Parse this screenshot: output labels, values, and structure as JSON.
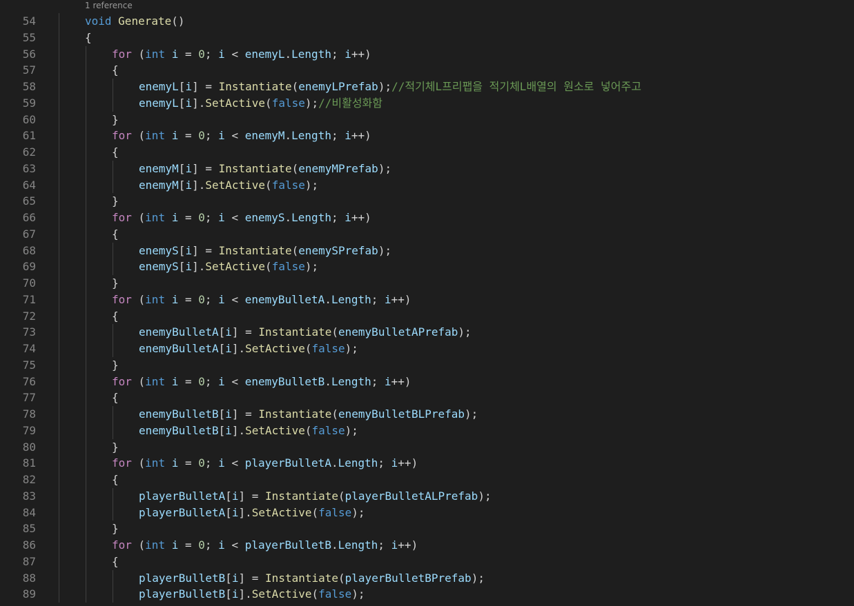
{
  "editor": {
    "codelens": "1 reference",
    "colors": {
      "background": "#1e1e1e",
      "line_number": "#858585",
      "keyword": "#569cd6",
      "control": "#c586c0",
      "function": "#dcdcaa",
      "variable": "#9cdcfe",
      "number": "#b5cea8",
      "comment": "#6a9955",
      "punctuation": "#d4d4d4"
    },
    "lines": [
      {
        "num": "54",
        "indent": 1,
        "tokens": [
          [
            "kw",
            "void"
          ],
          [
            "pn",
            " "
          ],
          [
            "fn",
            "Generate"
          ],
          [
            "pn",
            "()"
          ]
        ]
      },
      {
        "num": "55",
        "indent": 1,
        "tokens": [
          [
            "pn",
            "{"
          ]
        ]
      },
      {
        "num": "56",
        "indent": 2,
        "tokens": [
          [
            "ctl",
            "for"
          ],
          [
            "pn",
            " ("
          ],
          [
            "kw",
            "int"
          ],
          [
            "pn",
            " "
          ],
          [
            "var",
            "i"
          ],
          [
            "pn",
            " = "
          ],
          [
            "num",
            "0"
          ],
          [
            "pn",
            "; "
          ],
          [
            "var",
            "i"
          ],
          [
            "pn",
            " < "
          ],
          [
            "var",
            "enemyL"
          ],
          [
            "pn",
            "."
          ],
          [
            "var",
            "Length"
          ],
          [
            "pn",
            "; "
          ],
          [
            "var",
            "i"
          ],
          [
            "pn",
            "++)"
          ]
        ]
      },
      {
        "num": "57",
        "indent": 2,
        "tokens": [
          [
            "pn",
            "{"
          ]
        ]
      },
      {
        "num": "58",
        "indent": 3,
        "tokens": [
          [
            "var",
            "enemyL"
          ],
          [
            "pn",
            "["
          ],
          [
            "var",
            "i"
          ],
          [
            "pn",
            "] = "
          ],
          [
            "fn",
            "Instantiate"
          ],
          [
            "pn",
            "("
          ],
          [
            "var",
            "enemyLPrefab"
          ],
          [
            "pn",
            ");"
          ],
          [
            "cm",
            "//적기체L프리팹을 적기체L배열의 원소로 넣어주고"
          ]
        ]
      },
      {
        "num": "59",
        "indent": 3,
        "tokens": [
          [
            "var",
            "enemyL"
          ],
          [
            "pn",
            "["
          ],
          [
            "var",
            "i"
          ],
          [
            "pn",
            "]."
          ],
          [
            "fn",
            "SetActive"
          ],
          [
            "pn",
            "("
          ],
          [
            "kw",
            "false"
          ],
          [
            "pn",
            ");"
          ],
          [
            "cm",
            "//비활성화함"
          ]
        ]
      },
      {
        "num": "60",
        "indent": 2,
        "tokens": [
          [
            "pn",
            "}"
          ]
        ]
      },
      {
        "num": "61",
        "indent": 2,
        "tokens": [
          [
            "ctl",
            "for"
          ],
          [
            "pn",
            " ("
          ],
          [
            "kw",
            "int"
          ],
          [
            "pn",
            " "
          ],
          [
            "var",
            "i"
          ],
          [
            "pn",
            " = "
          ],
          [
            "num",
            "0"
          ],
          [
            "pn",
            "; "
          ],
          [
            "var",
            "i"
          ],
          [
            "pn",
            " < "
          ],
          [
            "var",
            "enemyM"
          ],
          [
            "pn",
            "."
          ],
          [
            "var",
            "Length"
          ],
          [
            "pn",
            "; "
          ],
          [
            "var",
            "i"
          ],
          [
            "pn",
            "++)"
          ]
        ]
      },
      {
        "num": "62",
        "indent": 2,
        "tokens": [
          [
            "pn",
            "{"
          ]
        ]
      },
      {
        "num": "63",
        "indent": 3,
        "tokens": [
          [
            "var",
            "enemyM"
          ],
          [
            "pn",
            "["
          ],
          [
            "var",
            "i"
          ],
          [
            "pn",
            "] = "
          ],
          [
            "fn",
            "Instantiate"
          ],
          [
            "pn",
            "("
          ],
          [
            "var",
            "enemyMPrefab"
          ],
          [
            "pn",
            ");"
          ]
        ]
      },
      {
        "num": "64",
        "indent": 3,
        "tokens": [
          [
            "var",
            "enemyM"
          ],
          [
            "pn",
            "["
          ],
          [
            "var",
            "i"
          ],
          [
            "pn",
            "]."
          ],
          [
            "fn",
            "SetActive"
          ],
          [
            "pn",
            "("
          ],
          [
            "kw",
            "false"
          ],
          [
            "pn",
            ");"
          ]
        ]
      },
      {
        "num": "65",
        "indent": 2,
        "tokens": [
          [
            "pn",
            "}"
          ]
        ]
      },
      {
        "num": "66",
        "indent": 2,
        "tokens": [
          [
            "ctl",
            "for"
          ],
          [
            "pn",
            " ("
          ],
          [
            "kw",
            "int"
          ],
          [
            "pn",
            " "
          ],
          [
            "var",
            "i"
          ],
          [
            "pn",
            " = "
          ],
          [
            "num",
            "0"
          ],
          [
            "pn",
            "; "
          ],
          [
            "var",
            "i"
          ],
          [
            "pn",
            " < "
          ],
          [
            "var",
            "enemyS"
          ],
          [
            "pn",
            "."
          ],
          [
            "var",
            "Length"
          ],
          [
            "pn",
            "; "
          ],
          [
            "var",
            "i"
          ],
          [
            "pn",
            "++)"
          ]
        ]
      },
      {
        "num": "67",
        "indent": 2,
        "tokens": [
          [
            "pn",
            "{"
          ]
        ]
      },
      {
        "num": "68",
        "indent": 3,
        "tokens": [
          [
            "var",
            "enemyS"
          ],
          [
            "pn",
            "["
          ],
          [
            "var",
            "i"
          ],
          [
            "pn",
            "] = "
          ],
          [
            "fn",
            "Instantiate"
          ],
          [
            "pn",
            "("
          ],
          [
            "var",
            "enemySPrefab"
          ],
          [
            "pn",
            ");"
          ]
        ]
      },
      {
        "num": "69",
        "indent": 3,
        "tokens": [
          [
            "var",
            "enemyS"
          ],
          [
            "pn",
            "["
          ],
          [
            "var",
            "i"
          ],
          [
            "pn",
            "]."
          ],
          [
            "fn",
            "SetActive"
          ],
          [
            "pn",
            "("
          ],
          [
            "kw",
            "false"
          ],
          [
            "pn",
            ");"
          ]
        ]
      },
      {
        "num": "70",
        "indent": 2,
        "tokens": [
          [
            "pn",
            "}"
          ]
        ]
      },
      {
        "num": "71",
        "indent": 2,
        "tokens": [
          [
            "ctl",
            "for"
          ],
          [
            "pn",
            " ("
          ],
          [
            "kw",
            "int"
          ],
          [
            "pn",
            " "
          ],
          [
            "var",
            "i"
          ],
          [
            "pn",
            " = "
          ],
          [
            "num",
            "0"
          ],
          [
            "pn",
            "; "
          ],
          [
            "var",
            "i"
          ],
          [
            "pn",
            " < "
          ],
          [
            "var",
            "enemyBulletA"
          ],
          [
            "pn",
            "."
          ],
          [
            "var",
            "Length"
          ],
          [
            "pn",
            "; "
          ],
          [
            "var",
            "i"
          ],
          [
            "pn",
            "++)"
          ]
        ]
      },
      {
        "num": "72",
        "indent": 2,
        "tokens": [
          [
            "pn",
            "{"
          ]
        ]
      },
      {
        "num": "73",
        "indent": 3,
        "tokens": [
          [
            "var",
            "enemyBulletA"
          ],
          [
            "pn",
            "["
          ],
          [
            "var",
            "i"
          ],
          [
            "pn",
            "] = "
          ],
          [
            "fn",
            "Instantiate"
          ],
          [
            "pn",
            "("
          ],
          [
            "var",
            "enemyBulletAPrefab"
          ],
          [
            "pn",
            ");"
          ]
        ]
      },
      {
        "num": "74",
        "indent": 3,
        "tokens": [
          [
            "var",
            "enemyBulletA"
          ],
          [
            "pn",
            "["
          ],
          [
            "var",
            "i"
          ],
          [
            "pn",
            "]."
          ],
          [
            "fn",
            "SetActive"
          ],
          [
            "pn",
            "("
          ],
          [
            "kw",
            "false"
          ],
          [
            "pn",
            ");"
          ]
        ]
      },
      {
        "num": "75",
        "indent": 2,
        "tokens": [
          [
            "pn",
            "}"
          ]
        ]
      },
      {
        "num": "76",
        "indent": 2,
        "tokens": [
          [
            "ctl",
            "for"
          ],
          [
            "pn",
            " ("
          ],
          [
            "kw",
            "int"
          ],
          [
            "pn",
            " "
          ],
          [
            "var",
            "i"
          ],
          [
            "pn",
            " = "
          ],
          [
            "num",
            "0"
          ],
          [
            "pn",
            "; "
          ],
          [
            "var",
            "i"
          ],
          [
            "pn",
            " < "
          ],
          [
            "var",
            "enemyBulletB"
          ],
          [
            "pn",
            "."
          ],
          [
            "var",
            "Length"
          ],
          [
            "pn",
            "; "
          ],
          [
            "var",
            "i"
          ],
          [
            "pn",
            "++)"
          ]
        ]
      },
      {
        "num": "77",
        "indent": 2,
        "tokens": [
          [
            "pn",
            "{"
          ]
        ]
      },
      {
        "num": "78",
        "indent": 3,
        "tokens": [
          [
            "var",
            "enemyBulletB"
          ],
          [
            "pn",
            "["
          ],
          [
            "var",
            "i"
          ],
          [
            "pn",
            "] = "
          ],
          [
            "fn",
            "Instantiate"
          ],
          [
            "pn",
            "("
          ],
          [
            "var",
            "enemyBulletBLPrefab"
          ],
          [
            "pn",
            ");"
          ]
        ]
      },
      {
        "num": "79",
        "indent": 3,
        "tokens": [
          [
            "var",
            "enemyBulletB"
          ],
          [
            "pn",
            "["
          ],
          [
            "var",
            "i"
          ],
          [
            "pn",
            "]."
          ],
          [
            "fn",
            "SetActive"
          ],
          [
            "pn",
            "("
          ],
          [
            "kw",
            "false"
          ],
          [
            "pn",
            ");"
          ]
        ]
      },
      {
        "num": "80",
        "indent": 2,
        "tokens": [
          [
            "pn",
            "}"
          ]
        ]
      },
      {
        "num": "81",
        "indent": 2,
        "tokens": [
          [
            "ctl",
            "for"
          ],
          [
            "pn",
            " ("
          ],
          [
            "kw",
            "int"
          ],
          [
            "pn",
            " "
          ],
          [
            "var",
            "i"
          ],
          [
            "pn",
            " = "
          ],
          [
            "num",
            "0"
          ],
          [
            "pn",
            "; "
          ],
          [
            "var",
            "i"
          ],
          [
            "pn",
            " < "
          ],
          [
            "var",
            "playerBulletA"
          ],
          [
            "pn",
            "."
          ],
          [
            "var",
            "Length"
          ],
          [
            "pn",
            "; "
          ],
          [
            "var",
            "i"
          ],
          [
            "pn",
            "++)"
          ]
        ]
      },
      {
        "num": "82",
        "indent": 2,
        "tokens": [
          [
            "pn",
            "{"
          ]
        ]
      },
      {
        "num": "83",
        "indent": 3,
        "tokens": [
          [
            "var",
            "playerBulletA"
          ],
          [
            "pn",
            "["
          ],
          [
            "var",
            "i"
          ],
          [
            "pn",
            "] = "
          ],
          [
            "fn",
            "Instantiate"
          ],
          [
            "pn",
            "("
          ],
          [
            "var",
            "playerBulletALPrefab"
          ],
          [
            "pn",
            ");"
          ]
        ]
      },
      {
        "num": "84",
        "indent": 3,
        "tokens": [
          [
            "var",
            "playerBulletA"
          ],
          [
            "pn",
            "["
          ],
          [
            "var",
            "i"
          ],
          [
            "pn",
            "]."
          ],
          [
            "fn",
            "SetActive"
          ],
          [
            "pn",
            "("
          ],
          [
            "kw",
            "false"
          ],
          [
            "pn",
            ");"
          ]
        ]
      },
      {
        "num": "85",
        "indent": 2,
        "tokens": [
          [
            "pn",
            "}"
          ]
        ]
      },
      {
        "num": "86",
        "indent": 2,
        "tokens": [
          [
            "ctl",
            "for"
          ],
          [
            "pn",
            " ("
          ],
          [
            "kw",
            "int"
          ],
          [
            "pn",
            " "
          ],
          [
            "var",
            "i"
          ],
          [
            "pn",
            " = "
          ],
          [
            "num",
            "0"
          ],
          [
            "pn",
            "; "
          ],
          [
            "var",
            "i"
          ],
          [
            "pn",
            " < "
          ],
          [
            "var",
            "playerBulletB"
          ],
          [
            "pn",
            "."
          ],
          [
            "var",
            "Length"
          ],
          [
            "pn",
            "; "
          ],
          [
            "var",
            "i"
          ],
          [
            "pn",
            "++)"
          ]
        ]
      },
      {
        "num": "87",
        "indent": 2,
        "tokens": [
          [
            "pn",
            "{"
          ]
        ]
      },
      {
        "num": "88",
        "indent": 3,
        "tokens": [
          [
            "var",
            "playerBulletB"
          ],
          [
            "pn",
            "["
          ],
          [
            "var",
            "i"
          ],
          [
            "pn",
            "] = "
          ],
          [
            "fn",
            "Instantiate"
          ],
          [
            "pn",
            "("
          ],
          [
            "var",
            "playerBulletBPrefab"
          ],
          [
            "pn",
            ");"
          ]
        ]
      },
      {
        "num": "89",
        "indent": 3,
        "tokens": [
          [
            "var",
            "playerBulletB"
          ],
          [
            "pn",
            "["
          ],
          [
            "var",
            "i"
          ],
          [
            "pn",
            "]."
          ],
          [
            "fn",
            "SetActive"
          ],
          [
            "pn",
            "("
          ],
          [
            "kw",
            "false"
          ],
          [
            "pn",
            ");"
          ]
        ]
      }
    ]
  }
}
